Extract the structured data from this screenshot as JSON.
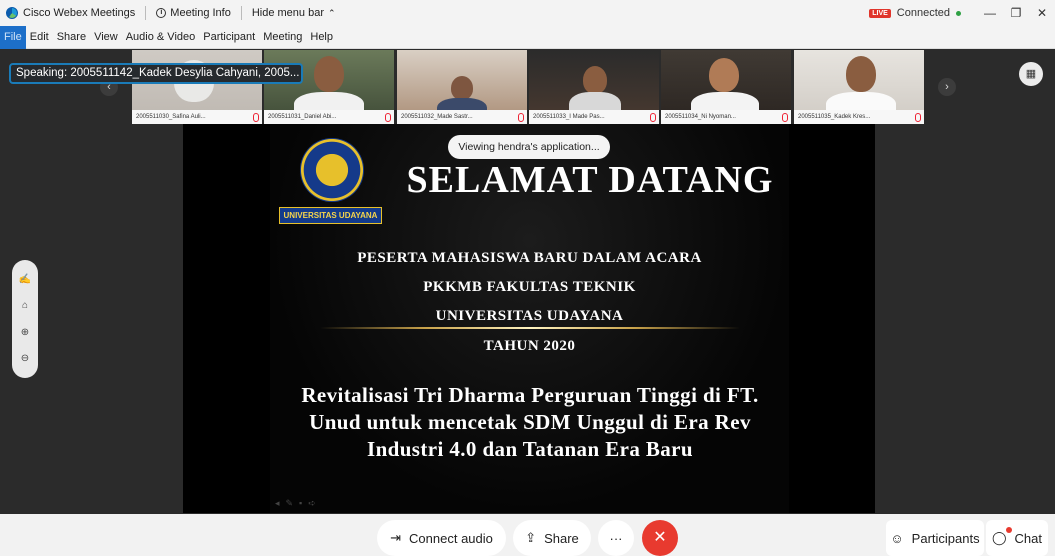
{
  "window": {
    "app_name": "Cisco Webex Meetings",
    "meeting_info": "Meeting Info",
    "hide_menu": "Hide menu bar",
    "live_badge": "LIVE",
    "status": "Connected",
    "minimize": "—",
    "restore": "❐",
    "close": "✕"
  },
  "menu": [
    "File",
    "Edit",
    "Share",
    "View",
    "Audio & Video",
    "Participant",
    "Meeting",
    "Help"
  ],
  "speaking": "Speaking: 2005511142_Kadek Desylia Cahyani, 2005...",
  "participants": [
    {
      "label": "2005511030_Safina Auli..."
    },
    {
      "label": "2005511031_Daniel Abi..."
    },
    {
      "label": "2005511032_Made Sastr..."
    },
    {
      "label": "2005511033_I Made Pas..."
    },
    {
      "label": "2005511034_Ni Nyoman..."
    },
    {
      "label": "2005511035_Kadek Kres..."
    }
  ],
  "viewing": "Viewing hendra's application...",
  "slide": {
    "university_tag": "UNIVERSITAS UDAYANA",
    "title": "SELAMAT DATANG",
    "line1": "PESERTA MAHASISWA BARU DALAM ACARA",
    "line2": "PKKMB FAKULTAS TEKNIK",
    "line3": "UNIVERSITAS UDAYANA",
    "line4": "TAHUN 2020",
    "theme1": "Revitalisasi Tri Dharma Perguruan Tinggi  di FT.",
    "theme2": "Unud untuk mencetak SDM Unggul di Era Rev",
    "theme3": "Industri 4.0 dan Tatanan Era Baru"
  },
  "controls": {
    "connect_audio": "Connect audio",
    "share": "Share",
    "more": "···",
    "participants": "Participants",
    "chat": "Chat"
  },
  "colors": {
    "accent": "#1d6fc9",
    "end": "#e83a2f",
    "live": "#e0352b"
  }
}
